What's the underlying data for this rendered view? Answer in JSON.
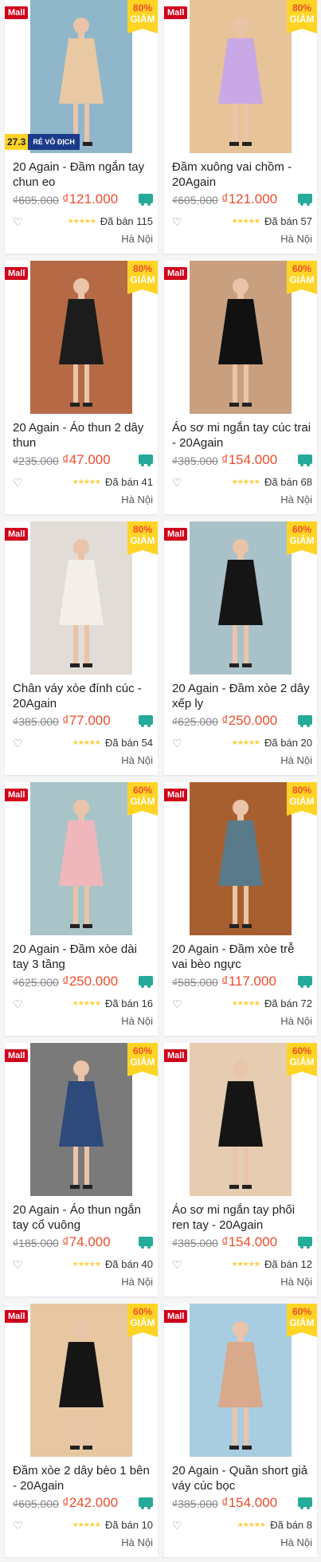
{
  "badges": {
    "mall": "Mall",
    "off": "GIẢM",
    "promo_date": "27.3",
    "promo_text": "RẺ VÔ ĐỊCH"
  },
  "products": [
    {
      "name": "20 Again - Đầm ngắn tay chun eo",
      "old_price": "₫605.000",
      "price": "₫121.000",
      "discount": "80%",
      "stars": "★★★★★",
      "sold": "Đã bán 115",
      "location": "Hà Nội",
      "bg": "#8fb6c9",
      "dress": "#e8c9a4",
      "promo": true
    },
    {
      "name": "Đầm xuông vai chồm - 20Again",
      "old_price": "₫605.000",
      "price": "₫121.000",
      "discount": "80%",
      "stars": "★★★★★",
      "sold": "Đã bán 57",
      "location": "Hà Nội",
      "bg": "#e7c39a",
      "dress": "#c9a8e6"
    },
    {
      "name": "20 Again - Áo thun 2 dây thun",
      "old_price": "₫235.000",
      "price": "₫47.000",
      "discount": "80%",
      "stars": "★★★★★",
      "sold": "Đã bán 41",
      "location": "Hà Nội",
      "bg": "#b56a45",
      "dress": "#1c1c1c"
    },
    {
      "name": "Áo sơ mi ngắn tay cúc trai - 20Again",
      "old_price": "₫385.000",
      "price": "₫154.000",
      "discount": "60%",
      "stars": "★★★★★",
      "sold": "Đã bán 68",
      "location": "Hà Nội",
      "bg": "#c8a080",
      "dress": "#111111"
    },
    {
      "name": "Chân váy xòe đính cúc - 20Again",
      "old_price": "₫385.000",
      "price": "₫77.000",
      "discount": "80%",
      "stars": "★★★★★",
      "sold": "Đã bán 54",
      "location": "Hà Nội",
      "bg": "#e2dcd6",
      "dress": "#f3efe8"
    },
    {
      "name": "20 Again - Đầm xòe 2 dây xếp ly",
      "old_price": "₫625.000",
      "price": "₫250.000",
      "discount": "60%",
      "stars": "★★★★★",
      "sold": "Đã bán 20",
      "location": "Hà Nội",
      "bg": "#a9c1c9",
      "dress": "#151515"
    },
    {
      "name": "20 Again - Đầm xòe dài tay 3 tầng",
      "old_price": "₫625.000",
      "price": "₫250.000",
      "discount": "60%",
      "stars": "★★★★★",
      "sold": "Đã bán 16",
      "location": "Hà Nội",
      "bg": "#a8c4c8",
      "dress": "#efb7bc"
    },
    {
      "name": "20 Again - Đầm xòe trễ vai bèo ngực",
      "old_price": "₫585.000",
      "price": "₫117.000",
      "discount": "80%",
      "stars": "★★★★★",
      "sold": "Đã bán 72",
      "location": "Hà Nội",
      "bg": "#a85f30",
      "dress": "#5a7a8a"
    },
    {
      "name": "20 Again - Áo thun ngắn tay cổ vuông",
      "old_price": "₫185.000",
      "price": "₫74.000",
      "discount": "60%",
      "stars": "★★★★★",
      "sold": "Đã bán 40",
      "location": "Hà Nội",
      "bg": "#7a7a7a",
      "dress": "#2e4a7a"
    },
    {
      "name": "Áo sơ mi ngắn tay phối ren tay - 20Again",
      "old_price": "₫385.000",
      "price": "₫154.000",
      "discount": "60%",
      "stars": "★★★★★",
      "sold": "Đã bán 12",
      "location": "Hà Nội",
      "bg": "#e6ccb0",
      "dress": "#151515"
    },
    {
      "name": "Đầm xòe 2 dây bèo 1 bên - 20Again",
      "old_price": "₫605.000",
      "price": "₫242.000",
      "discount": "60%",
      "stars": "★★★★★",
      "sold": "Đã bán 10",
      "location": "Hà Nội",
      "bg": "#e7c7a2",
      "dress": "#151515"
    },
    {
      "name": "20 Again - Quần short giả váy cúc bọc",
      "old_price": "₫385.000",
      "price": "₫154.000",
      "discount": "60%",
      "stars": "★★★★★",
      "sold": "Đã bán 8",
      "location": "Hà Nội",
      "bg": "#a8cde0",
      "dress": "#d8a98a"
    }
  ]
}
